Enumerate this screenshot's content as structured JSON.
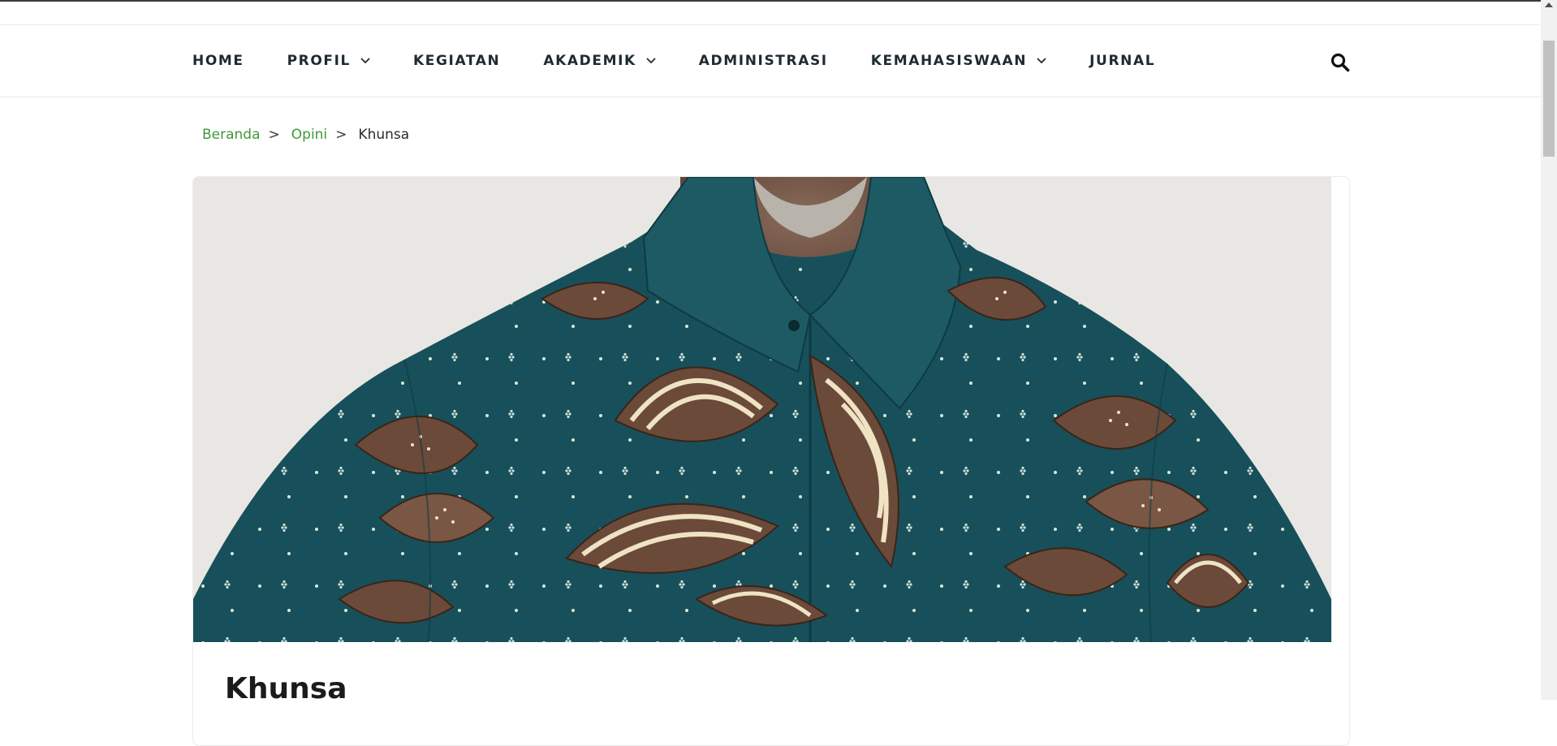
{
  "nav": {
    "items": [
      {
        "label": "HOME",
        "has_dropdown": false
      },
      {
        "label": "PROFIL",
        "has_dropdown": true
      },
      {
        "label": "KEGIATAN",
        "has_dropdown": false
      },
      {
        "label": "AKADEMIK",
        "has_dropdown": true
      },
      {
        "label": "ADMINISTRASI",
        "has_dropdown": false
      },
      {
        "label": "KEMAHASISWAAN",
        "has_dropdown": true
      },
      {
        "label": "JURNAL",
        "has_dropdown": false
      }
    ],
    "search_icon": "search-icon"
  },
  "breadcrumb": {
    "items": [
      {
        "label": "Beranda",
        "link": true
      },
      {
        "label": "Opini",
        "link": true
      },
      {
        "label": "Khunsa",
        "link": false
      }
    ],
    "separator": ">"
  },
  "post": {
    "title": "Khunsa",
    "hero_image": "batik-shirt-photo"
  },
  "colors": {
    "link": "#3f9a3a",
    "nav_text": "#1f2a30",
    "batik_teal": "#17505a",
    "batik_brown": "#6b4a3a",
    "batik_cream": "#efe3c4"
  }
}
